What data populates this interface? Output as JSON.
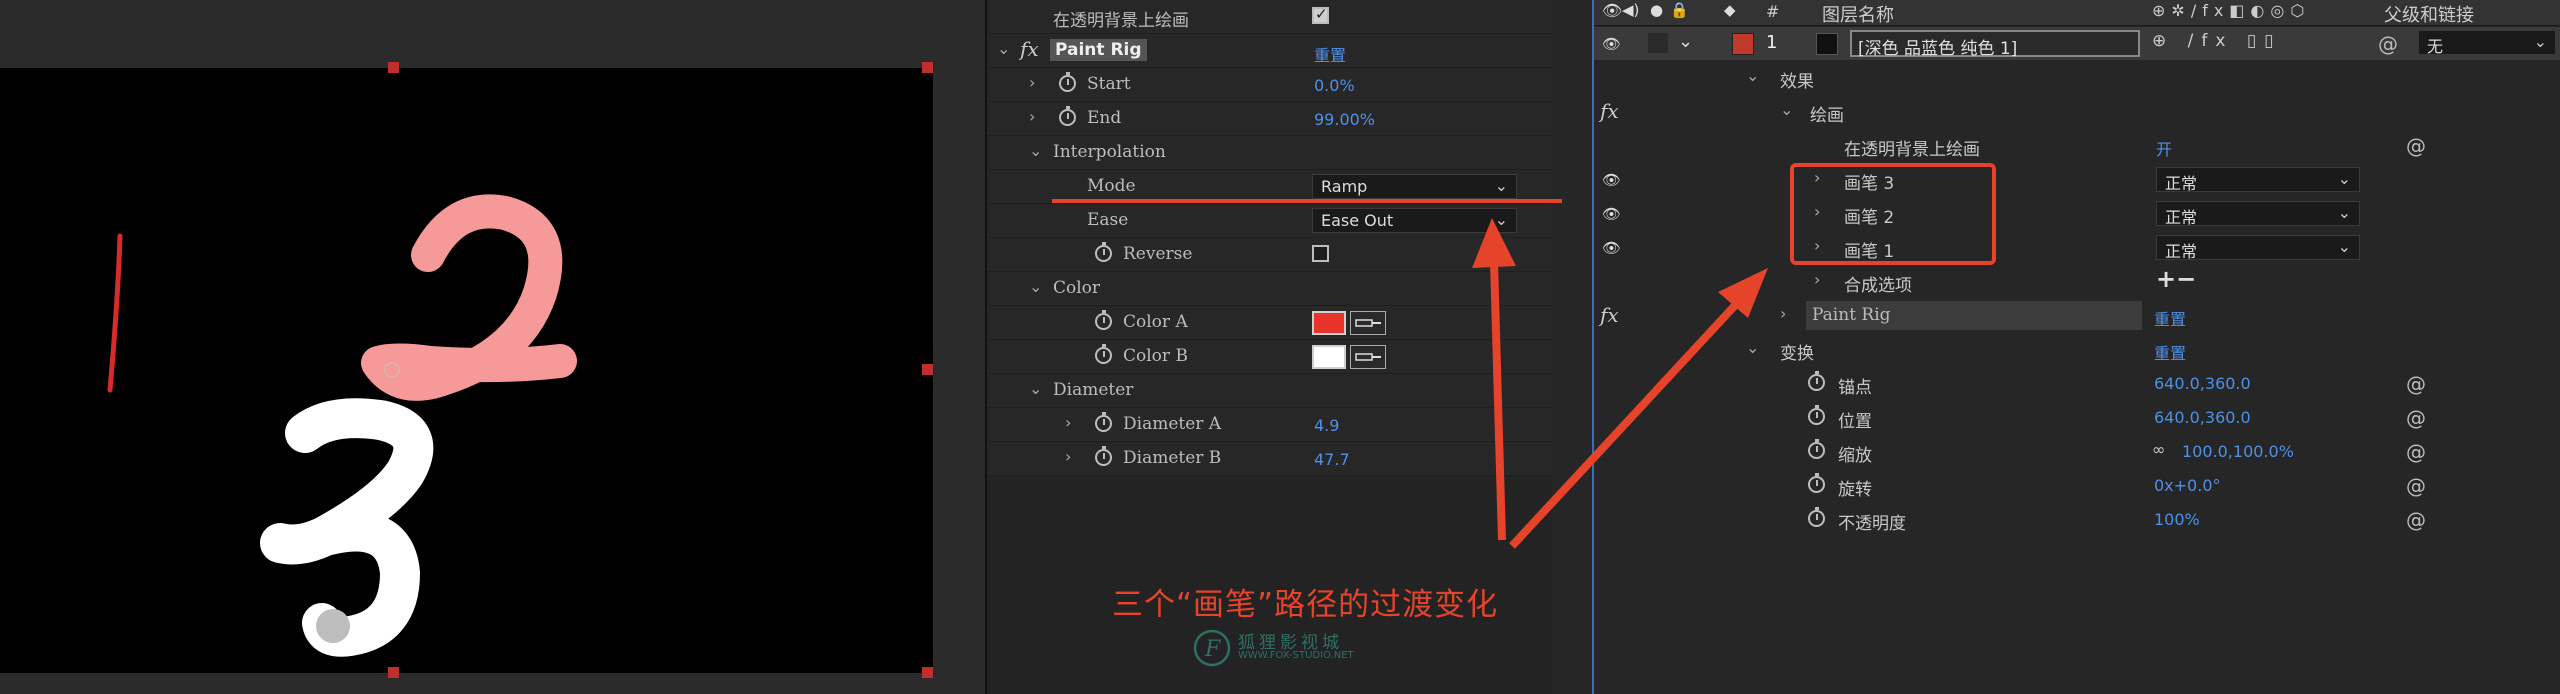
{
  "composition": {
    "number_1": "1",
    "number_2": "2",
    "number_3": "3"
  },
  "effect_controls": {
    "top_prop_label": "在透明背景上绘画",
    "top_prop_checked": true,
    "effect_name": "Paint Rig",
    "reset_label": "重置",
    "start_label": "Start",
    "start_value": "0.0%",
    "end_label": "End",
    "end_value": "99.00%",
    "interpolation_label": "Interpolation",
    "mode_label": "Mode",
    "mode_value": "Ramp",
    "ease_label": "Ease",
    "ease_value": "Ease Out",
    "reverse_label": "Reverse",
    "reverse_checked": false,
    "color_group_label": "Color",
    "color_a_label": "Color A",
    "color_a_value": "#e8332a",
    "color_b_label": "Color B",
    "color_b_value": "#ffffff",
    "diameter_label": "Diameter",
    "diameter_a_label": "Diameter A",
    "diameter_a_value": "4.9",
    "diameter_b_label": "Diameter B",
    "diameter_b_value": "47.7"
  },
  "timeline": {
    "header": {
      "hash": "#",
      "layer_name_col": "图层名称",
      "parent_col": "父级和链接"
    },
    "layer": {
      "index": "1",
      "name": "[深色 品蓝色 纯色 1]",
      "label_color": "#c0392b",
      "parent": "无"
    },
    "effects_group": "效果",
    "paint_group": "绘画",
    "paint_on_transparent": "在透明背景上绘画",
    "paint_on_transparent_value": "开",
    "strokes": [
      {
        "label": "画笔 3",
        "mode": "正常"
      },
      {
        "label": "画笔 2",
        "mode": "正常"
      },
      {
        "label": "画笔 1",
        "mode": "正常"
      }
    ],
    "composite_options": "合成选项",
    "add_remove": "+−",
    "paint_rig": "Paint Rig",
    "paint_rig_reset": "重置",
    "transform": "变换",
    "transform_reset": "重置",
    "anchor_label": "锚点",
    "anchor_value": "640.0,360.0",
    "position_label": "位置",
    "position_value": "640.0,360.0",
    "scale_label": "缩放",
    "scale_value": "100.0,100.0%",
    "rotation_label": "旋转",
    "rotation_value": "0x+0.0°",
    "opacity_label": "不透明度",
    "opacity_value": "100%"
  },
  "annotation": {
    "caption": "三个“画笔”路径的过渡变化",
    "watermark_cn": "狐狸影视城",
    "watermark_url": "WWW.FOX-STUDIO.NET",
    "accent_color": "#e5432a"
  }
}
